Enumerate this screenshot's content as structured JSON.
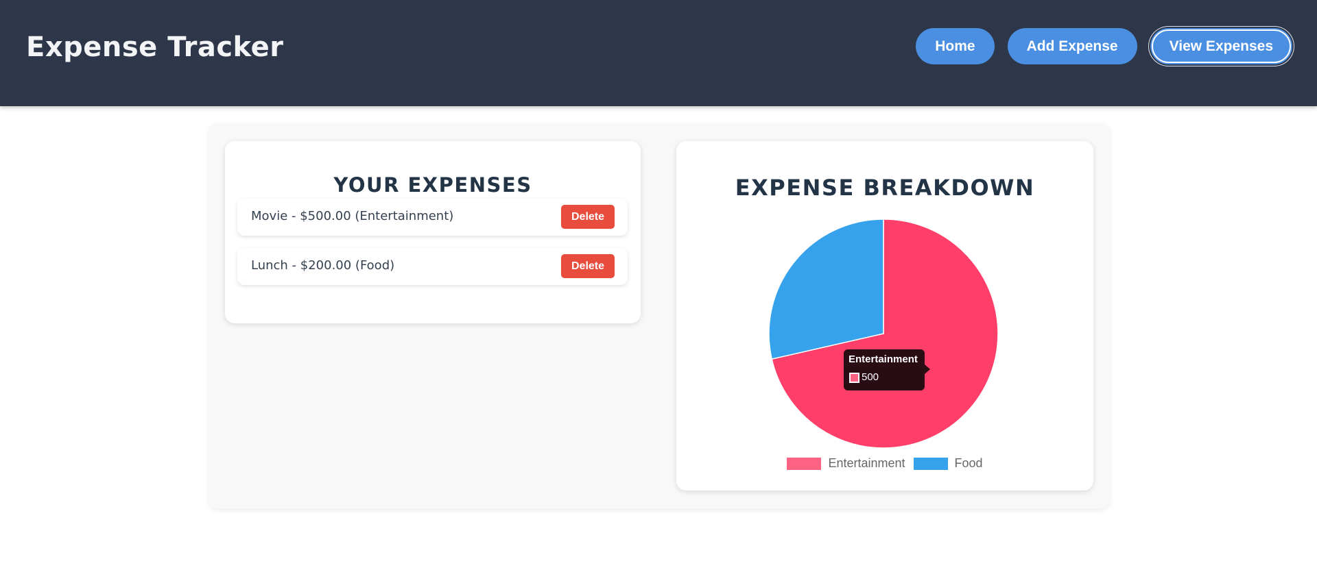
{
  "header": {
    "title": "Expense Tracker",
    "nav": [
      {
        "label": "Home"
      },
      {
        "label": "Add Expense"
      },
      {
        "label": "View Expenses"
      }
    ]
  },
  "expenses_card": {
    "heading": "YOUR EXPENSES",
    "items": [
      {
        "text": "Movie - $500.00 (Entertainment)",
        "delete_label": "Delete"
      },
      {
        "text": "Lunch - $200.00 (Food)",
        "delete_label": "Delete"
      }
    ]
  },
  "breakdown_card": {
    "heading": "EXPENSE BREAKDOWN",
    "tooltip": {
      "title": "Entertainment",
      "value": "500"
    }
  },
  "colors": {
    "header_bg": "#2e3749",
    "nav_button": "#4a8fe2",
    "delete_button": "#e74c3c",
    "heading_text": "#233446"
  },
  "chart_data": {
    "type": "pie",
    "categories": [
      "Entertainment",
      "Food"
    ],
    "values": [
      500,
      200
    ],
    "colors": [
      "#ff3f69",
      "#36a2eb"
    ],
    "legend_colors": [
      "#ff6384",
      "#36a2eb"
    ],
    "legend": "bottom"
  }
}
